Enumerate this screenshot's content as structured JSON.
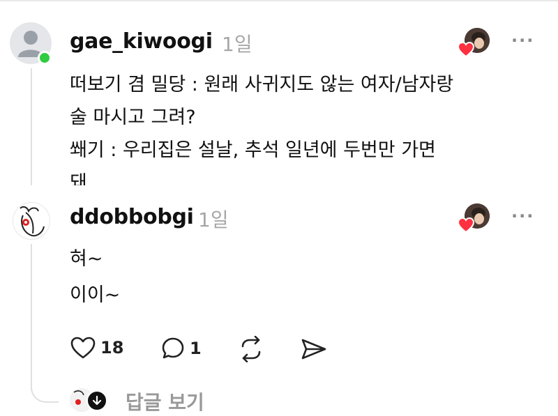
{
  "comments": [
    {
      "username": "gae_kiwoogi",
      "time": "1일",
      "avatar_icon": "default-user-icon",
      "online": true,
      "lines": [
        "떠보기 겸 밀당 : 원래 사귀지도 않는 여자/남자랑",
        "술 마시고 그려?",
        "쐐기 : 우리집은 설날, 추석 일년에 두번만 가면",
        "돼"
      ]
    },
    {
      "username": "ddobbobgi",
      "time": "1일",
      "lines": [
        "혀~",
        "이이~"
      ],
      "actions": {
        "likes": "18",
        "comments": "1"
      }
    }
  ],
  "view_replies_label": "답글 보기",
  "colors": {
    "heart": "#ff3040",
    "online": "#2ecc40",
    "muted": "#999999"
  }
}
